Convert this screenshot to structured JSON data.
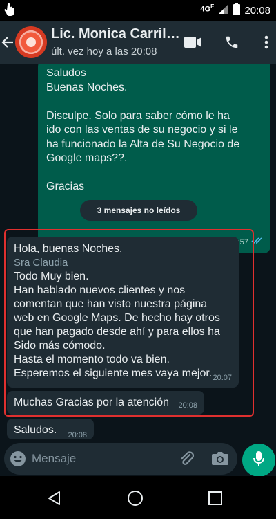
{
  "status_bar": {
    "network": "4G",
    "network_sup": "E",
    "time": "20:08"
  },
  "header": {
    "contact_name": "Lic. Monica Carril…",
    "last_seen": "últ. vez hoy a las 20:08",
    "icons": [
      "back-arrow-icon",
      "video-call-icon",
      "phone-icon",
      "more-vert-icon"
    ]
  },
  "messages": {
    "outgoing": {
      "lines": [
        "Saludos",
        "Buenas Noches.",
        "",
        "Disculpe. Solo para saber cómo le ha",
        "ido con las ventas de su negocio y si le",
        "ha funcionado la Alta de Su Negocio de",
        "Google maps??.",
        "",
        "Gracias"
      ],
      "time": "19:57",
      "status": "read",
      "tick_color": "#53bdeb"
    },
    "unread_divider": "3 mensajes no leídos",
    "incoming": [
      {
        "first_line": "Hola, buenas Noches.",
        "sender": "Sra Claudia",
        "lines": [
          "Todo Muy bien.",
          "Han hablado nuevos clientes y nos",
          "comentan que han visto nuestra página",
          "web en Google  Maps.  De hecho hay otros",
          "que han pagado desde ahí y para ellos ha",
          "Sido más cómodo.",
          "Hasta el momento todo va bien.",
          "Esperemos el siguiente mes vaya mejor."
        ],
        "time": "20:07"
      },
      {
        "text": "Muchas Gracias por la atención",
        "time": "20:08"
      },
      {
        "text": "Saludos.",
        "time": "20:08"
      }
    ]
  },
  "composer": {
    "placeholder": "Mensaje"
  },
  "colors": {
    "background": "#0b141a",
    "header": "#1f2c34",
    "outgoing_bubble": "#005c4b",
    "incoming_bubble": "#1f2c34",
    "accent": "#00a884",
    "highlight_border": "#e0302f"
  }
}
